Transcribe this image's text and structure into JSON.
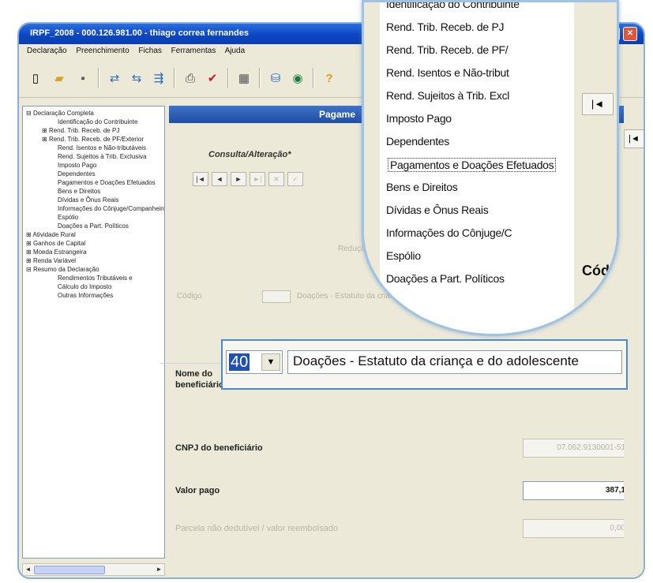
{
  "window": {
    "title": "IRPF_2008 - 000.126.981.00 - thiago correa fernandes"
  },
  "menu": [
    "Declaração",
    "Preenchimento",
    "Fichas",
    "Ferramentas",
    "Ajuda"
  ],
  "toolbar": [
    "new-icon",
    "open-icon",
    "save-icon",
    "import-icon",
    "export-icon",
    "transmit-icon",
    "print-icon",
    "verify-icon",
    "calculator-icon",
    "database-icon",
    "globe-icon",
    "help-icon"
  ],
  "tree": [
    {
      "text": "Declaração Completa",
      "level": "l0",
      "prefix": "⊟ "
    },
    {
      "text": "Identificação do Contribuinte",
      "level": "l1n",
      "prefix": ""
    },
    {
      "text": "Rend. Trib. Receb. de PJ",
      "level": "l1",
      "prefix": "⊞ "
    },
    {
      "text": "Rend. Trib. Receb. de PF/Exterior",
      "level": "l1",
      "prefix": "⊞ "
    },
    {
      "text": "Rend. Isentos e Não-tributáveis",
      "level": "l1n",
      "prefix": ""
    },
    {
      "text": "Rend. Sujeitos à Trib. Exclusiva",
      "level": "l1n",
      "prefix": ""
    },
    {
      "text": "Imposto Pago",
      "level": "l1n",
      "prefix": ""
    },
    {
      "text": "Dependentes",
      "level": "l1n",
      "prefix": ""
    },
    {
      "text": "Pagamentos e Doações Efetuados",
      "level": "l1n",
      "prefix": ""
    },
    {
      "text": "Bens e Direitos",
      "level": "l1n",
      "prefix": ""
    },
    {
      "text": "Dívidas e Ônus Reais",
      "level": "l1n",
      "prefix": ""
    },
    {
      "text": "Informações do Cônjuge/Companheiro",
      "level": "l1n",
      "prefix": ""
    },
    {
      "text": "Espólio",
      "level": "l1n",
      "prefix": ""
    },
    {
      "text": "Doações a Part. Políticos",
      "level": "l1n",
      "prefix": ""
    },
    {
      "text": "Atividade Rural",
      "level": "l0",
      "prefix": "⊞ "
    },
    {
      "text": "Ganhos de Capital",
      "level": "l0",
      "prefix": "⊞ "
    },
    {
      "text": "Moeda Estrangeira",
      "level": "l0",
      "prefix": "⊞ "
    },
    {
      "text": "Renda Variável",
      "level": "l0",
      "prefix": "⊞ "
    },
    {
      "text": "Resumo da Declaração",
      "level": "l0",
      "prefix": "⊟ "
    },
    {
      "text": "Rendimentos Tributáveis e",
      "level": "l1n",
      "prefix": ""
    },
    {
      "text": "Cálculo do Imposto",
      "level": "l1n",
      "prefix": ""
    },
    {
      "text": "Outras Informações",
      "level": "l1n",
      "prefix": ""
    }
  ],
  "panel": {
    "title": "Pagame",
    "consulta_label": "Consulta/Alteração*",
    "nav": [
      "|◄",
      "◄",
      "►",
      "►|",
      "✕",
      "✓"
    ],
    "faded_help": "Redução do IR",
    "codigo_label": "Código",
    "codigo_desc": "Doações - Estatuto da criança",
    "nome_label_1": "Nome do",
    "nome_label_2": "beneficiário",
    "cnpj_label": "CNPJ do beneficiário",
    "cnpj_value": "07.062.9130001-51",
    "valor_label": "Valor pago",
    "valor_value": "387,1",
    "parcela_label": "Parcela não dedutível / valor reembolsado",
    "parcela_value": "0,00"
  },
  "zoom_list": {
    "items": [
      "Identificação do Contribuinte",
      "Rend. Trib. Receb. de PJ",
      "Rend. Trib. Receb. de PF/",
      "Rend. Isentos e Não-tribut",
      "Rend. Sujeitos à Trib. Excl",
      "Imposto Pago",
      "Dependentes",
      "Pagamentos e Doações Efetuados",
      "Bens e Direitos",
      "Dívidas e Ônus Reais",
      "Informações do Cônjuge/C",
      "Espólio",
      "Doações a Part. Políticos"
    ],
    "selected_index": 7,
    "cod_label": "Cód",
    "first_button": "|◄"
  },
  "zoom_field": {
    "code": "40",
    "dropdown": "▼",
    "text": "Doações - Estatuto da criança e do adolescente"
  }
}
